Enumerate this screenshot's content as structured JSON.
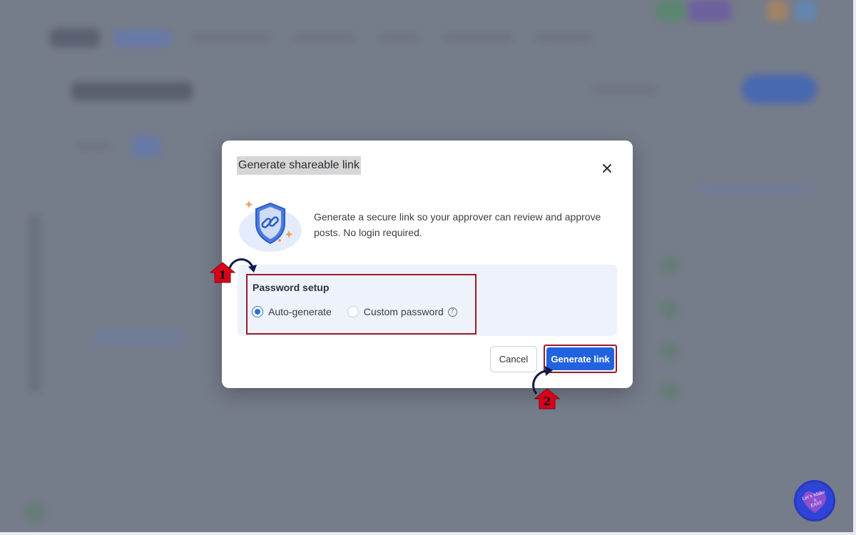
{
  "modal": {
    "title": "Generate shareable link",
    "close_icon": "close-icon",
    "description": "Generate a secure link so your approver can review and approve posts. No login required.",
    "hero_icon": "shield-link-icon",
    "password_setup": {
      "label": "Password setup",
      "options": [
        {
          "label": "Auto-generate",
          "selected": true
        },
        {
          "label": "Custom password",
          "selected": false
        }
      ],
      "help_icon": "question-circle-icon"
    },
    "cancel_label": "Cancel",
    "generate_label": "Generate link"
  },
  "annotations": {
    "step1": "1",
    "step2": "2"
  },
  "colors": {
    "accent": "#2062e0",
    "highlight_border": "#9b1b28",
    "panel_bg": "#eef2fb",
    "marker_red": "#d8001a"
  }
}
